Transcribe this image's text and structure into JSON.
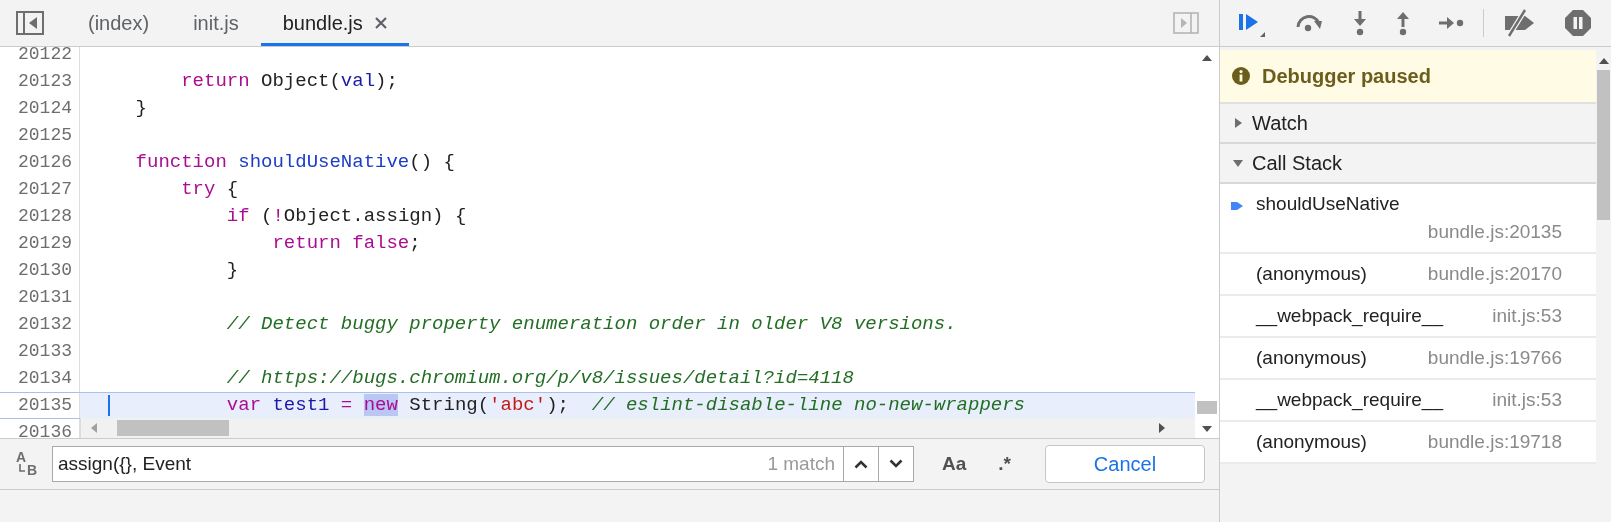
{
  "editor_tabs": [
    {
      "label": "(index)",
      "selected": false,
      "closable": false
    },
    {
      "label": "init.js",
      "selected": false,
      "closable": false
    },
    {
      "label": "bundle.js",
      "selected": true,
      "closable": true
    }
  ],
  "code": {
    "lines": [
      {
        "number": "20122",
        "current": false
      },
      {
        "number": "20123",
        "current": false,
        "tokens": [
          {
            "kind": "keyword",
            "text": "        return"
          },
          {
            "kind": "plain",
            "text": " Object("
          },
          {
            "kind": "variable",
            "text": "val"
          },
          {
            "kind": "plain",
            "text": ");"
          }
        ]
      },
      {
        "number": "20124",
        "current": false,
        "tokens": [
          {
            "kind": "plain",
            "text": "    }"
          }
        ]
      },
      {
        "number": "20125",
        "current": false
      },
      {
        "number": "20126",
        "current": false,
        "tokens": [
          {
            "kind": "keyword",
            "text": "    function "
          },
          {
            "kind": "definition",
            "text": "shouldUseNative"
          },
          {
            "kind": "plain",
            "text": "() {"
          }
        ]
      },
      {
        "number": "20127",
        "current": false,
        "tokens": [
          {
            "kind": "keyword",
            "text": "        try"
          },
          {
            "kind": "plain",
            "text": " {"
          }
        ]
      },
      {
        "number": "20128",
        "current": false,
        "tokens": [
          {
            "kind": "keyword",
            "text": "            if"
          },
          {
            "kind": "plain",
            "text": " ("
          },
          {
            "kind": "operator",
            "text": "!"
          },
          {
            "kind": "plain",
            "text": "Object.assign) {"
          }
        ]
      },
      {
        "number": "20129",
        "current": false,
        "tokens": [
          {
            "kind": "keyword",
            "text": "                return false"
          },
          {
            "kind": "plain",
            "text": ";"
          }
        ]
      },
      {
        "number": "20130",
        "current": false,
        "tokens": [
          {
            "kind": "plain",
            "text": "            }"
          }
        ]
      },
      {
        "number": "20131",
        "current": false
      },
      {
        "number": "20132",
        "current": false,
        "tokens": [
          {
            "kind": "comment",
            "text": "            // Detect buggy property enumeration order in older V8 versions."
          }
        ]
      },
      {
        "number": "20133",
        "current": false
      },
      {
        "number": "20134",
        "current": false,
        "tokens": [
          {
            "kind": "comment",
            "text": "            // https://bugs.chromium.org/p/v8/issues/detail?id=4118"
          }
        ]
      },
      {
        "number": "20135",
        "current": true,
        "tokens": [
          {
            "kind": "keyword",
            "text": "            var "
          },
          {
            "kind": "variable",
            "text": "test1 "
          },
          {
            "kind": "operator",
            "text": "= "
          },
          {
            "kind": "match",
            "text": "new"
          },
          {
            "kind": "plain",
            "text": " String("
          },
          {
            "kind": "string",
            "text": "'abc'"
          },
          {
            "kind": "plain",
            "text": ");  "
          },
          {
            "kind": "comment",
            "text": "// eslint-disable-line no-new-wrappers"
          }
        ]
      },
      {
        "number": "20136",
        "current": false
      }
    ]
  },
  "search_bar": {
    "replace_toggle": [
      "A",
      "B"
    ],
    "query": "assign({}, Event",
    "match_count": "1 match",
    "match_case": "Aa",
    "regex": ".*",
    "cancel": "Cancel"
  },
  "debugger": {
    "status": "Debugger paused",
    "sections": [
      {
        "title": "Watch",
        "expanded": false
      },
      {
        "title": "Call Stack",
        "expanded": true
      }
    ],
    "call_stack": [
      {
        "function": "shouldUseNative",
        "location": "bundle.js:20135",
        "selected": true
      },
      {
        "function": "(anonymous)",
        "location": "bundle.js:20170",
        "selected": false
      },
      {
        "function": "__webpack_require__",
        "location": "init.js:53",
        "selected": false
      },
      {
        "function": "(anonymous)",
        "location": "bundle.js:19766",
        "selected": false
      },
      {
        "function": "__webpack_require__",
        "location": "init.js:53",
        "selected": false
      },
      {
        "function": "(anonymous)",
        "location": "bundle.js:19718",
        "selected": false
      }
    ]
  }
}
